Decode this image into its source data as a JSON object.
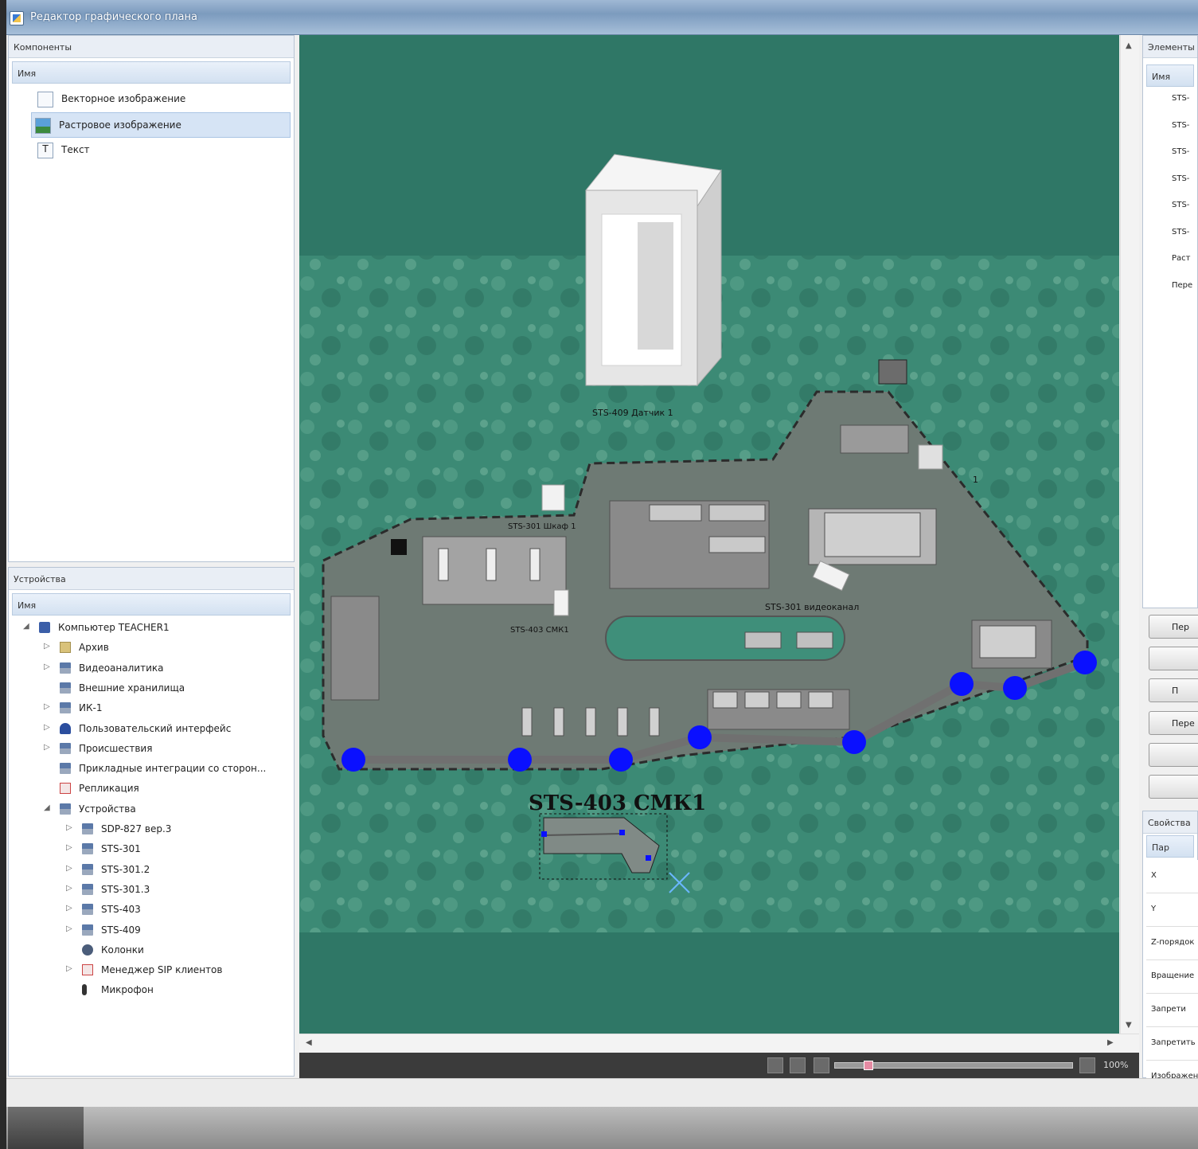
{
  "window": {
    "title": "Редактор графического плана"
  },
  "components_panel": {
    "header": "Компоненты",
    "column": "Имя",
    "items": [
      {
        "label": "Векторное изображение",
        "icon": "vector-image-icon",
        "selected": false
      },
      {
        "label": "Растровое изображение",
        "icon": "raster-image-icon",
        "selected": true
      },
      {
        "label": "Текст",
        "icon": "text-icon",
        "selected": false
      }
    ]
  },
  "devices_panel": {
    "header": "Устройства",
    "column": "Имя",
    "tree": [
      {
        "label": "Компьютер TEACHER1",
        "expander": "◢",
        "icon": "computer-icon"
      },
      {
        "label": "Архив",
        "expander": "▷",
        "icon": "archive-icon"
      },
      {
        "label": "Видеоаналитика",
        "expander": "▷",
        "icon": "device-group-icon"
      },
      {
        "label": "Внешние хранилища",
        "expander": "",
        "icon": "device-group-icon"
      },
      {
        "label": "ИК-1",
        "expander": "▷",
        "icon": "device-group-icon"
      },
      {
        "label": "Пользовательский интерфейс",
        "expander": "▷",
        "icon": "user-interface-icon"
      },
      {
        "label": "Происшествия",
        "expander": "▷",
        "icon": "device-group-icon"
      },
      {
        "label": "Прикладные интеграции со сторон...",
        "expander": "",
        "icon": "device-group-icon"
      },
      {
        "label": "Репликация",
        "expander": "",
        "icon": "replication-icon"
      },
      {
        "label": "Устройства",
        "expander": "◢",
        "icon": "device-group-icon"
      },
      {
        "label": "SDP-827 вер.3",
        "expander": "▷",
        "icon": "device-group-icon"
      },
      {
        "label": "STS-301",
        "expander": "▷",
        "icon": "device-group-icon"
      },
      {
        "label": "STS-301.2",
        "expander": "▷",
        "icon": "device-group-icon"
      },
      {
        "label": "STS-301.3",
        "expander": "▷",
        "icon": "device-group-icon"
      },
      {
        "label": "STS-403",
        "expander": "▷",
        "icon": "device-group-icon"
      },
      {
        "label": "STS-409",
        "expander": "▷",
        "icon": "device-group-icon"
      },
      {
        "label": "Колонки",
        "expander": "",
        "icon": "speaker-icon"
      },
      {
        "label": "Менеджер SIP клиентов",
        "expander": "▷",
        "icon": "sip-manager-icon"
      },
      {
        "label": "Микрофон",
        "expander": "",
        "icon": "microphone-icon"
      }
    ]
  },
  "canvas": {
    "labels": {
      "sensor": "STS-409 Датчик 1",
      "cabinet": "STS-301 Шкаф 1",
      "cmk_small": "STS-403 СМК1",
      "video": "STS-301 видеоканал",
      "right_device": "1",
      "big_label": "STS-403 СМК1",
      "big_label_shadow": "STS-403 СМК1"
    },
    "colors": {
      "background": "#2f7766",
      "terrain": "#3f8f7a",
      "node": "#0a10ff"
    }
  },
  "zoom": {
    "label": "100%",
    "slider_fraction": 0.12
  },
  "elements_panel": {
    "header": "Элементы",
    "column": "Имя",
    "items": [
      "STS-",
      "STS-",
      "STS-",
      "STS-",
      "STS-",
      "STS-",
      "Раст",
      "Пере"
    ]
  },
  "buttons": [
    "Пер",
    "",
    "П",
    "Пере",
    "",
    ""
  ],
  "properties_panel": {
    "header": "Свойства",
    "column": "Пар",
    "rows": [
      "X",
      "Y",
      "Z-порядок",
      "Вращение",
      "Запрети",
      "Запретить масштаб",
      "Изображение"
    ]
  }
}
